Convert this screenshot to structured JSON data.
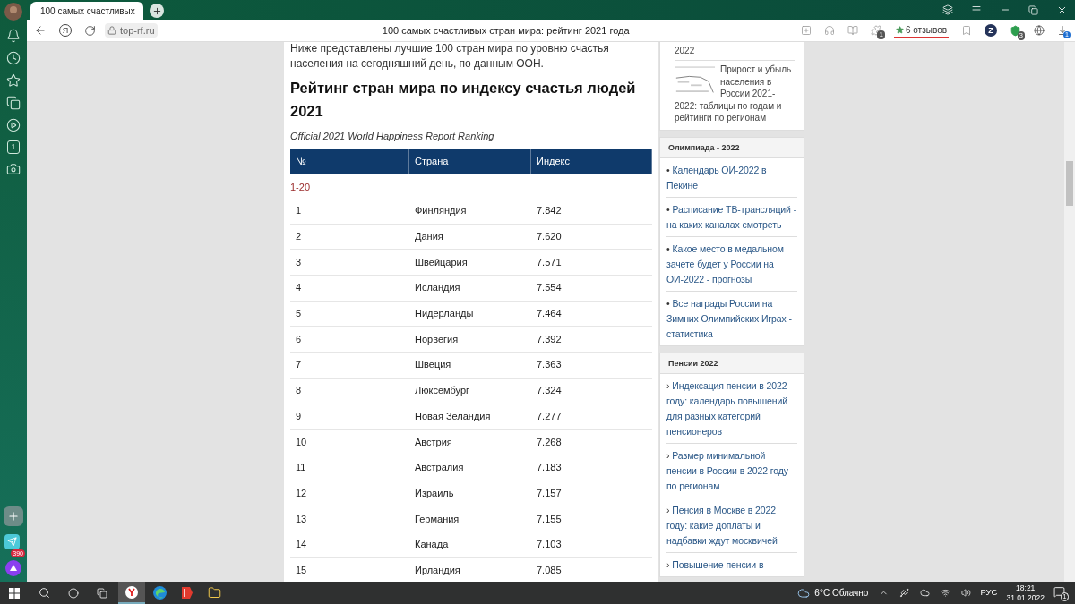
{
  "browser": {
    "tab": {
      "title": "100 самых счастливых",
      "selected": true
    },
    "url": "top-rf.ru",
    "yandex_logo": "Я",
    "page_title": "100 самых счастливых стран мира: рейтинг 2021 года",
    "reviews": "6 отзывов",
    "extension_badge": "1",
    "z_logo": "Z",
    "shield_badge": "3",
    "download_badge": "1"
  },
  "left_panel": {
    "counter": "1",
    "messenger_badge": "390"
  },
  "article": {
    "intro": "Ниже представлены лучшие 100 стран мира по уровню счастья населения на сегодняшний день, по данным ООН.",
    "heading": "Рейтинг стран мира по индексу счастья людей 2021",
    "caption": "Official 2021 World Happiness Report Ranking",
    "table": {
      "columns": [
        "№",
        "Страна",
        "Индекс"
      ],
      "group": "1-20",
      "rows": [
        [
          "1",
          "Финляндия",
          "7.842"
        ],
        [
          "2",
          "Дания",
          "7.620"
        ],
        [
          "3",
          "Швейцария",
          "7.571"
        ],
        [
          "4",
          "Исландия",
          "7.554"
        ],
        [
          "5",
          "Нидерланды",
          "7.464"
        ],
        [
          "6",
          "Норвегия",
          "7.392"
        ],
        [
          "7",
          "Швеция",
          "7.363"
        ],
        [
          "8",
          "Люксембург",
          "7.324"
        ],
        [
          "9",
          "Новая Зеландия",
          "7.277"
        ],
        [
          "10",
          "Австрия",
          "7.268"
        ],
        [
          "11",
          "Австралия",
          "7.183"
        ],
        [
          "12",
          "Израиль",
          "7.157"
        ],
        [
          "13",
          "Германия",
          "7.155"
        ],
        [
          "14",
          "Канада",
          "7.103"
        ],
        [
          "15",
          "Ирландия",
          "7.085"
        ]
      ]
    }
  },
  "sidebar": {
    "top_widget": {
      "cut_text": "2022",
      "item": "Прирост и убыль населения в России 2021-2022: таблицы по годам и рейтинги по регионам"
    },
    "widgets": [
      {
        "title": "Олимпиада - 2022",
        "marker": "•",
        "items": [
          "Календарь ОИ-2022 в Пекине",
          "Расписание ТВ-трансляций - на каких каналах смотреть",
          "Какое место в медальном зачете будет у России на ОИ-2022 - прогнозы",
          "Все награды России на Зимних Олимпийских Играх - статистика"
        ]
      },
      {
        "title": "Пенсии 2022",
        "marker": "›",
        "items": [
          "Индексация пенсии в 2022 году: календарь повышений для разных категорий пенсионеров",
          "Размер минимальной пенсии в России в 2022 году по регионам",
          "Пенсия в Москве в 2022 году: какие доплаты и надбавки ждут москвичей",
          "Повышение пенсии в"
        ]
      }
    ]
  },
  "taskbar": {
    "weather": "6°C Облачно",
    "language": "РУС",
    "time": "18:21",
    "date": "31.01.2022",
    "notifications": "1"
  }
}
